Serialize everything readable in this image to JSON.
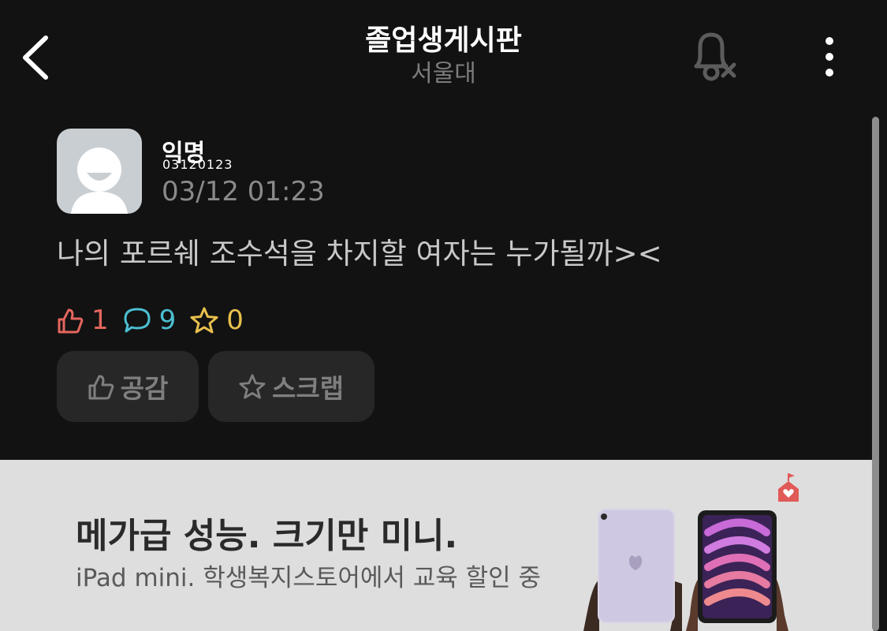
{
  "header": {
    "title": "졸업생게시판",
    "subtitle": "서울대"
  },
  "post": {
    "author": "익명",
    "author_id": "03120123",
    "time": "03/12 01:23",
    "body": "나의 포르쉐 조수석을 차지할 여자는 누가될까><"
  },
  "stats": {
    "likes": "1",
    "comments": "9",
    "scraps": "0"
  },
  "actions": {
    "like_label": "공감",
    "scrap_label": "스크랩"
  },
  "ad": {
    "headline": "메가급 성능. 크기만 미니.",
    "subline": "iPad mini. 학생복지스토어에서 교육 할인 중"
  },
  "colors": {
    "background": "#121212",
    "like": "#e5665e",
    "comment": "#4bbfd1",
    "scrap": "#e8c04d",
    "ad_background": "#dedede"
  },
  "icons": [
    "back-arrow-icon",
    "bell-off-icon",
    "more-vertical-icon",
    "thumbs-up-icon",
    "comment-icon",
    "star-icon",
    "store-logo-icon"
  ]
}
